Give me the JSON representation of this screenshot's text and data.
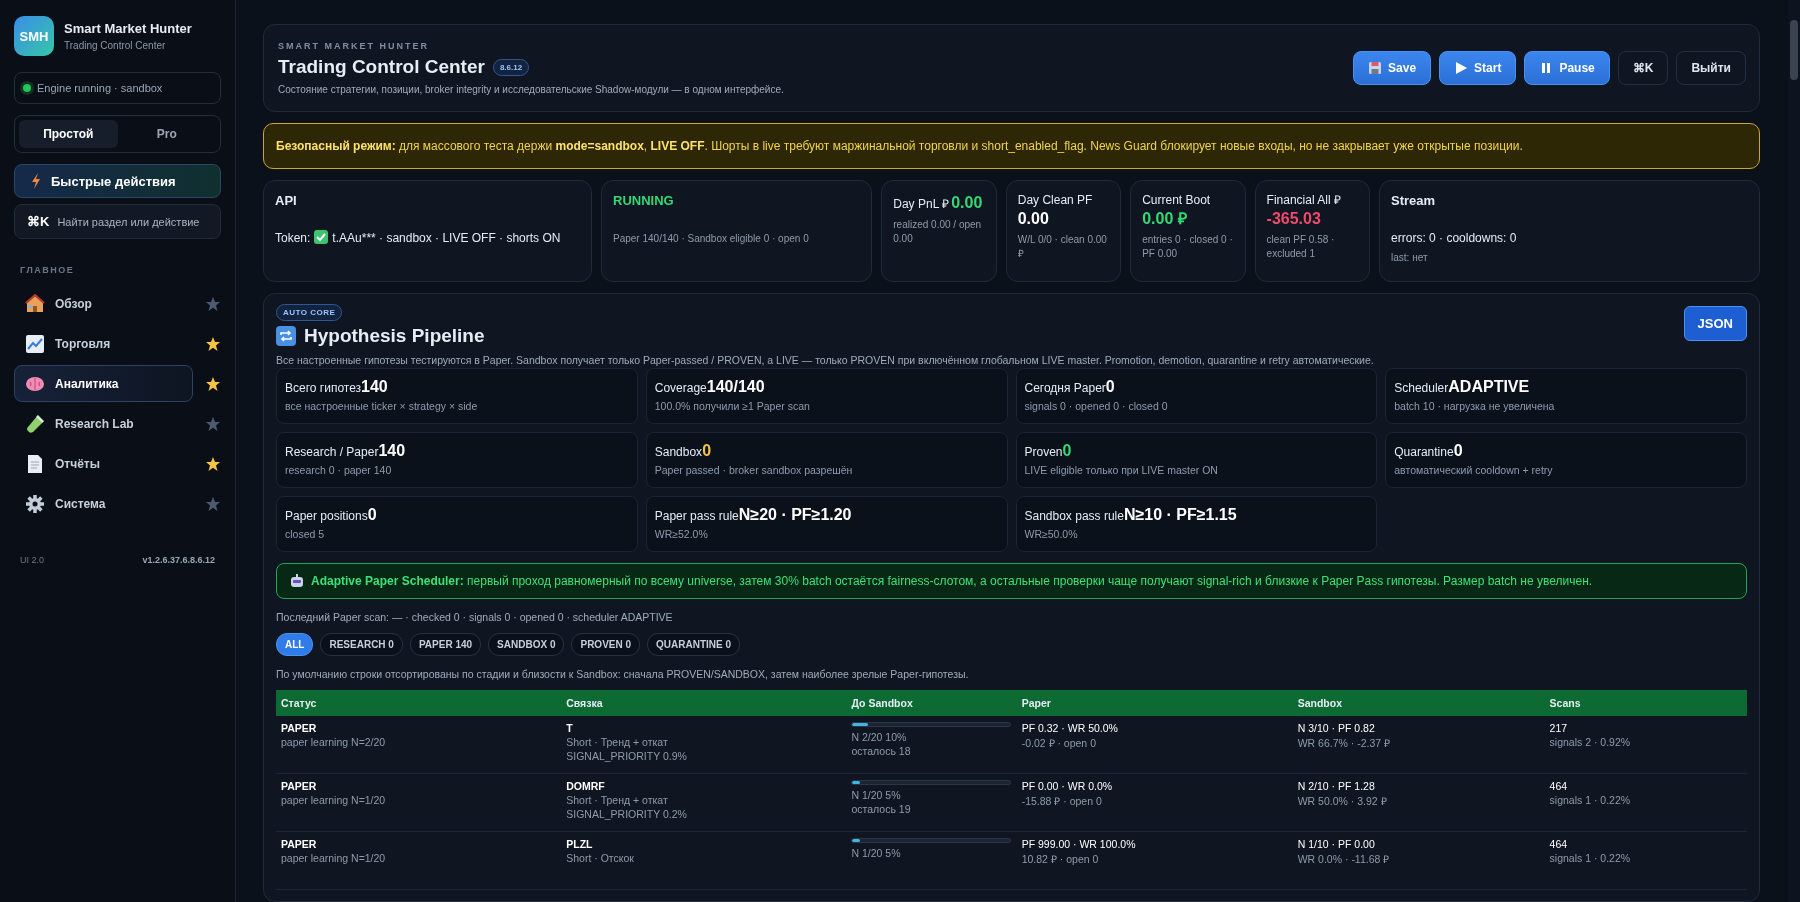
{
  "sidebar": {
    "logo": "SMH",
    "app_name": "Smart Market Hunter",
    "app_subtitle": "Trading Control Center",
    "engine_status": {
      "text": "Engine running · sandbox",
      "on": true
    },
    "modes": [
      {
        "label": "Простой",
        "selected": true
      },
      {
        "label": "Pro",
        "selected": false
      }
    ],
    "quick_actions": "Быстрые действия",
    "search": {
      "shortcut": "⌘K",
      "placeholder": "Найти раздел или действие"
    },
    "section": "ГЛАВНОЕ",
    "items": [
      {
        "label": "Обзор",
        "selected": false,
        "favorite": false
      },
      {
        "label": "Торговля",
        "selected": false,
        "favorite": true
      },
      {
        "label": "Аналитика",
        "selected": true,
        "favorite": true
      },
      {
        "label": "Research Lab",
        "selected": false,
        "favorite": false
      },
      {
        "label": "Отчёты",
        "selected": false,
        "favorite": true
      },
      {
        "label": "Система",
        "selected": false,
        "favorite": false
      }
    ],
    "footer": {
      "ui": "UI 2.0",
      "version": "v1.2.6.37.6.8.6.12"
    }
  },
  "header": {
    "eyebrow": "SMART MARKET HUNTER",
    "title": "Trading Control Center",
    "version": "8.6.12",
    "description": "Состояние стратегии, позиции, broker integrity и исследовательские Shadow-модули — в одном интерфейсе.",
    "buttons": [
      {
        "label": "Save",
        "kind": "save"
      },
      {
        "label": "Start",
        "kind": "start"
      },
      {
        "label": "Pause",
        "kind": "pause"
      },
      {
        "label": "⌘K",
        "kind": "ghost"
      },
      {
        "label": "Выйти",
        "kind": "ghost"
      }
    ]
  },
  "warning": "**Безопасный режим:** для массового теста держи **mode=sandbox**, **LIVE OFF**. Шорты в live требуют маржинальной торговли и short_enabled_flag. News Guard блокирует новые входы, но не закрывает уже открытые позиции.",
  "stats": [
    {
      "kind": "info",
      "title": "API",
      "prefix": "Token:",
      "token_ok": true,
      "body": "t.AAu*** · sandbox · LIVE OFF · shorts ON"
    },
    {
      "kind": "status",
      "title": "RUNNING",
      "sub": "Paper 140/140 · Sandbox eligible 0 · open 0"
    },
    {
      "kind": "money",
      "label": "Day PnL ₽",
      "value": "0.00",
      "color": "#34d874",
      "sub": "realized 0.00 / open 0.00"
    },
    {
      "kind": "money",
      "label": "Day Clean PF",
      "value": "0.00",
      "color": "#ffffff",
      "sub": "W/L 0/0 · clean 0.00 ₽"
    },
    {
      "kind": "money",
      "label": "Current Boot",
      "value": "0.00 ₽",
      "color": "#34d874",
      "sub": "entries 0 · closed 0 · PF 0.00"
    },
    {
      "kind": "money",
      "label": "Financial All ₽",
      "value": "-365.03",
      "color": "#f04a6c",
      "sub": "clean PF 0.58 · excluded 1"
    },
    {
      "kind": "info",
      "title": "Stream",
      "body": "errors: 0 · cooldowns: 0",
      "sub": "last: нет"
    }
  ],
  "pipeline": {
    "badge": "AUTO CORE",
    "title": "Hypothesis Pipeline",
    "action": "JSON",
    "description": "Все настроенные гипотезы тестируются в Paper. Sandbox получает только Paper-passed / PROVEN, а LIVE — только PROVEN при включённом глобальном LIVE master. Promotion, demotion, quarantine и retry автоматические.",
    "metrics": [
      {
        "label": "Всего гипотез",
        "value": "140",
        "color": "#ffffff",
        "sub": "все настроенные ticker × strategy × side"
      },
      {
        "label": "Coverage",
        "value": "140/140",
        "color": "#ffffff",
        "sub": "100.0% получили ≥1 Paper scan"
      },
      {
        "label": "Сегодня Paper",
        "value": "0",
        "color": "#ffffff",
        "sub": "signals 0 · opened 0 · closed 0"
      },
      {
        "label": "Scheduler",
        "value": "ADAPTIVE",
        "color": "#ffffff",
        "sub": "batch 10 · нагрузка не увеличена"
      },
      {
        "label": "Research / Paper",
        "value": "140",
        "color": "#ffffff",
        "sub": "research 0 · paper 140"
      },
      {
        "label": "Sandbox",
        "value": "0",
        "color": "#f5c242",
        "sub": "Paper passed · broker sandbox разрешён"
      },
      {
        "label": "Proven",
        "value": "0",
        "color": "#34d874",
        "sub": "LIVE eligible только при LIVE master ON"
      },
      {
        "label": "Quarantine",
        "value": "0",
        "color": "#ffffff",
        "sub": "автоматический cooldown + retry"
      },
      {
        "label": "Paper positions",
        "value": "0",
        "color": "#ffffff",
        "sub": "closed 5"
      },
      {
        "label": "Paper pass rule",
        "value": "N≥20 · PF≥1.20",
        "color": "#ffffff",
        "sub": "WR≥52.0%"
      },
      {
        "label": "Sandbox pass rule",
        "value": "N≥10 · PF≥1.15",
        "color": "#ffffff",
        "sub": "WR≥50.0%"
      }
    ],
    "scheduler_note": "**Adaptive Paper Scheduler:** первый проход равномерный по всему universe, затем 30% batch остаётся fairness-слотом, а остальные проверки чаще получают signal-rich и близкие к Paper Pass гипотезы. Размер batch не увеличен.",
    "last_scan": "Последний Paper scan: — · checked 0 · signals 0 · opened 0 · scheduler ADAPTIVE",
    "filters": [
      {
        "label": "ALL",
        "selected": true
      },
      {
        "label": "RESEARCH 0",
        "selected": false
      },
      {
        "label": "PAPER 140",
        "selected": false
      },
      {
        "label": "SANDBOX 0",
        "selected": false
      },
      {
        "label": "PROVEN 0",
        "selected": false
      },
      {
        "label": "QUARANTINE 0",
        "selected": false
      }
    ],
    "sort_note": "По умолчанию строки отсортированы по стадии и близости к Sandbox: сначала PROVEN/SANDBOX, затем наиболее зрелые Paper-гипотезы.",
    "table": {
      "columns": [
        "Статус",
        "Связка",
        "До Sandbox",
        "Paper",
        "Sandbox",
        "Scans"
      ],
      "rows": [
        {
          "status": "PAPER",
          "status_note": "paper learning N=2/20",
          "ticker": "T",
          "strategy": "Short · Тренд + откат",
          "priority": "SIGNAL_PRIORITY 0.9%",
          "level": 0.1,
          "progress": "N 2/20 10%",
          "remaining": "осталось 18",
          "paper": "PF 0.32 · WR 50.0%",
          "paper_note": "-0.02 ₽ · open 0",
          "sandbox": "N 3/10 · PF 0.82",
          "sandbox_note": "WR 66.7% · -2.37 ₽",
          "scans": "217",
          "scans_note": "signals 2 · 0.92%"
        },
        {
          "status": "PAPER",
          "status_note": "paper learning N=1/20",
          "ticker": "DOMRF",
          "strategy": "Short · Тренд + откат",
          "priority": "SIGNAL_PRIORITY 0.2%",
          "level": 0.05,
          "progress": "N 1/20 5%",
          "remaining": "осталось 19",
          "paper": "PF 0.00 · WR 0.0%",
          "paper_note": "-15.88 ₽ · open 0",
          "sandbox": "N 2/10 · PF 1.28",
          "sandbox_note": "WR 50.0% · 3.92 ₽",
          "scans": "464",
          "scans_note": "signals 1 · 0.22%"
        },
        {
          "status": "PAPER",
          "status_note": "paper learning N=1/20",
          "ticker": "PLZL",
          "strategy": "Short · Отскок",
          "level": 0.05,
          "progress": "N 1/20 5%",
          "paper": "PF 999.00 · WR 100.0%",
          "paper_note": "10.82 ₽ · open 0",
          "sandbox": "N 1/10 · PF 0.00",
          "sandbox_note": "WR 0.0% · -11.68 ₽",
          "scans": "464",
          "scans_note": "signals 1 · 0.22%"
        }
      ]
    }
  }
}
